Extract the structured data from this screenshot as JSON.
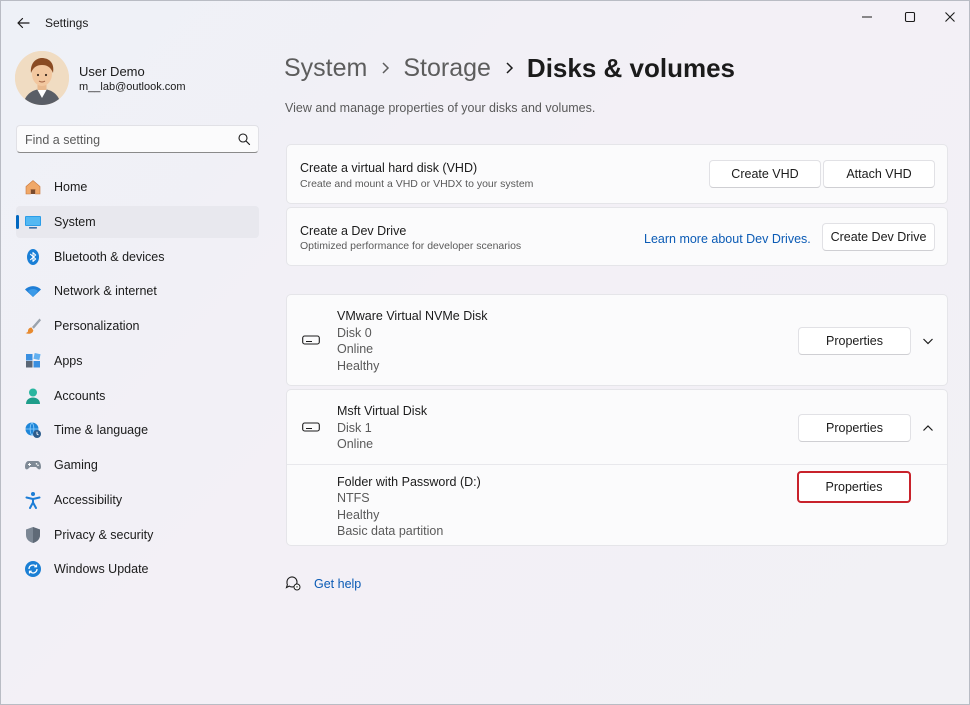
{
  "app": {
    "title": "Settings"
  },
  "user": {
    "name": "User Demo",
    "email": "m__lab@outlook.com"
  },
  "search": {
    "placeholder": "Find a setting"
  },
  "sidebar": {
    "items": [
      {
        "label": "Home",
        "icon": "home-icon"
      },
      {
        "label": "System",
        "icon": "system-icon",
        "active": true
      },
      {
        "label": "Bluetooth & devices",
        "icon": "bluetooth-icon"
      },
      {
        "label": "Network & internet",
        "icon": "wifi-icon"
      },
      {
        "label": "Personalization",
        "icon": "brush-icon"
      },
      {
        "label": "Apps",
        "icon": "apps-icon"
      },
      {
        "label": "Accounts",
        "icon": "accounts-icon"
      },
      {
        "label": "Time & language",
        "icon": "globe-clock-icon"
      },
      {
        "label": "Gaming",
        "icon": "gamepad-icon"
      },
      {
        "label": "Accessibility",
        "icon": "accessibility-icon"
      },
      {
        "label": "Privacy & security",
        "icon": "shield-icon"
      },
      {
        "label": "Windows Update",
        "icon": "update-icon"
      }
    ]
  },
  "breadcrumb": {
    "level1": "System",
    "level2": "Storage",
    "current": "Disks & volumes"
  },
  "main": {
    "subtitle": "View and manage properties of your disks and volumes.",
    "vhd": {
      "title": "Create a virtual hard disk (VHD)",
      "desc": "Create and mount a VHD or VHDX to your system",
      "create_label": "Create VHD",
      "attach_label": "Attach VHD"
    },
    "devdrive": {
      "title": "Create a Dev Drive",
      "desc": "Optimized performance for developer scenarios",
      "link": "Learn more about Dev Drives.",
      "button_label": "Create Dev Drive"
    },
    "disks": [
      {
        "name": "VMware Virtual NVMe Disk",
        "number": "Disk 0",
        "status": "Online",
        "health": "Healthy",
        "button_label": "Properties",
        "expanded": false
      },
      {
        "name": "Msft Virtual Disk",
        "number": "Disk 1",
        "status": "Online",
        "button_label": "Properties",
        "expanded": true,
        "volumes": [
          {
            "name": "Folder with Password (D:)",
            "fs": "NTFS",
            "health": "Healthy",
            "type": "Basic data partition",
            "button_label": "Properties"
          }
        ]
      }
    ],
    "help_label": "Get help"
  },
  "colors": {
    "accent": "#0067c0",
    "link": "#0b5bb5",
    "highlight": "#c8222b"
  }
}
